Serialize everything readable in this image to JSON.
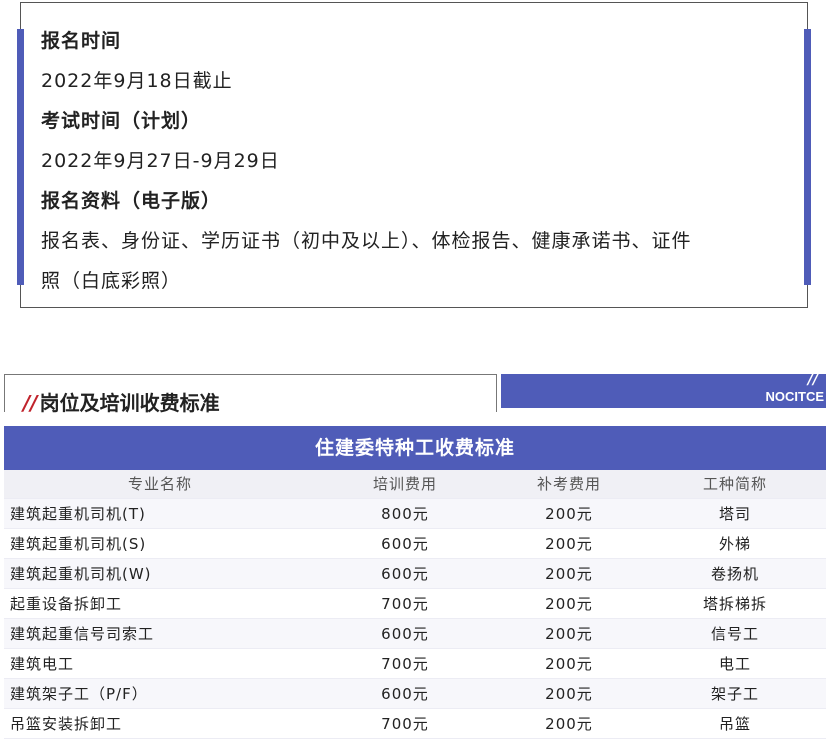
{
  "info": {
    "lines": [
      {
        "text": "报名时间",
        "bold": true
      },
      {
        "text": "2022年9月18日截止",
        "bold": false
      },
      {
        "text": "考试时间（计划）",
        "bold": true
      },
      {
        "text": "2022年9月27日-9月29日",
        "bold": false
      },
      {
        "text": "报名资料（电子版）",
        "bold": true
      },
      {
        "text": "报名表、身份证、学历证书（初中及以上）、体检报告、健康承诺书、证件",
        "bold": false
      },
      {
        "text": "照（白底彩照）",
        "bold": false
      }
    ]
  },
  "section": {
    "slashes": "//",
    "title": "岗位及培训收费标准",
    "brand_slashes": "//",
    "brand": "NOCITCE"
  },
  "table": {
    "title": "住建委特种工收费标准",
    "headers": [
      "专业名称",
      "培训费用",
      "补考费用",
      "工种简称"
    ],
    "rows": [
      [
        "建筑起重机司机(T)",
        "800元",
        "200元",
        "塔司"
      ],
      [
        "建筑起重机司机(S)",
        "600元",
        "200元",
        "外梯"
      ],
      [
        "建筑起重机司机(W)",
        "600元",
        "200元",
        "卷扬机"
      ],
      [
        "起重设备拆卸工",
        "700元",
        "200元",
        "塔拆梯拆"
      ],
      [
        "建筑起重信号司索工",
        "600元",
        "200元",
        "信号工"
      ],
      [
        "建筑电工",
        "700元",
        "200元",
        "电工"
      ],
      [
        "建筑架子工（P/F）",
        "600元",
        "200元",
        "架子工"
      ],
      [
        "吊篮安装拆卸工",
        "700元",
        "200元",
        "吊篮"
      ]
    ]
  },
  "colors": {
    "accent": "#4f5cb8",
    "slash": "#c0232c"
  }
}
